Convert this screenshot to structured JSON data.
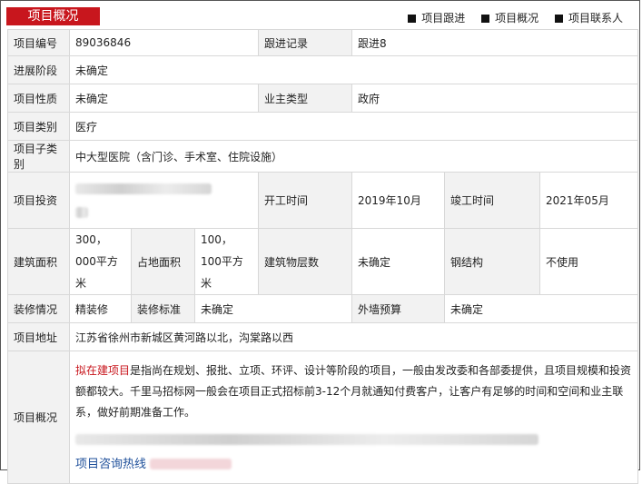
{
  "header": {
    "tab_title": "项目概况",
    "nav": [
      "项目跟进",
      "项目概况",
      "项目联系人"
    ]
  },
  "rows": {
    "project_no_label": "项目编号",
    "project_no": "89036846",
    "followup_label": "跟进记录",
    "followup_value": "跟进8",
    "stage_label": "进展阶段",
    "stage_value": "未确定",
    "nature_label": "项目性质",
    "nature_value": "未确定",
    "owner_type_label": "业主类型",
    "owner_type_value": "政府",
    "category_label": "项目类别",
    "category_value": "医疗",
    "subcategory_label": "项目子类别",
    "subcategory_value": "中大型医院（含门诊、手术室、住院设施）",
    "investment_label": "项目投资",
    "start_label": "开工时间",
    "start_value": "2019年10月",
    "finish_label": "竣工时间",
    "finish_value": "2021年05月",
    "build_area_label": "建筑面积",
    "build_area_value": "300，000平方米",
    "land_area_label": "占地面积",
    "land_area_value": "100，100平方米",
    "floors_label": "建筑物层数",
    "floors_value": "未确定",
    "steel_label": "钢结构",
    "steel_value": "不使用",
    "decor_label": "装修情况",
    "decor_value": "精装修",
    "decor_std_label": "装修标准",
    "decor_std_value": "未确定",
    "wall_budget_label": "外墙预算",
    "wall_budget_value": "未确定",
    "address_label": "项目地址",
    "address_value": "江苏省徐州市新城区黄河路以北，沟棠路以西",
    "overview_label": "项目概况",
    "overview_link": "拟在建项目",
    "overview_text": "是指尚在规划、报批、立项、环评、设计等阶段的项目，一般由发改委和各部委提供，且项目规模和投资额都较大。千里马招标网一般会在项目正式招标前3-12个月就通知付费客户，让客户有足够的时间和空间和业主联系，做好前期准备工作。",
    "hotline": "项目咨询热线"
  },
  "colors": {
    "accent": "#c8161d",
    "link_blue": "#1e4f9a"
  }
}
